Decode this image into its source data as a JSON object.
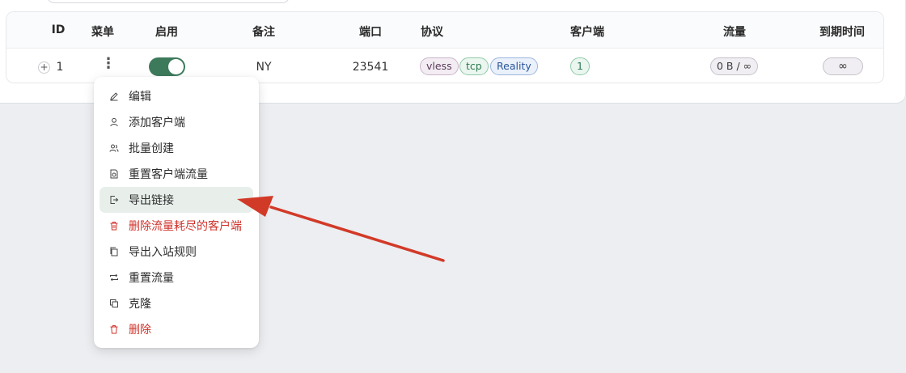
{
  "table": {
    "headers": {
      "id": "ID",
      "menu": "菜单",
      "enable": "启用",
      "remark": "备注",
      "port": "端口",
      "protocol": "协议",
      "clients": "客户端",
      "traffic": "流量",
      "expiry": "到期时间"
    },
    "row": {
      "id": "1",
      "remark": "NY",
      "port": "23541",
      "protocol_tags": [
        "vless",
        "tcp",
        "Reality"
      ],
      "clients": "1",
      "traffic": "0 B / ∞",
      "expiry": "∞",
      "enabled": true
    }
  },
  "menu": {
    "items": [
      {
        "label": "编辑",
        "icon": "edit-icon"
      },
      {
        "label": "添加客户端",
        "icon": "user-add-icon"
      },
      {
        "label": "批量创建",
        "icon": "users-icon"
      },
      {
        "label": "重置客户端流量",
        "icon": "file-reset-icon"
      },
      {
        "label": "导出链接",
        "icon": "export-icon",
        "active": true
      },
      {
        "label": "删除流量耗尽的客户端",
        "icon": "trash-icon",
        "danger": true
      },
      {
        "label": "导出入站规则",
        "icon": "copy-icon"
      },
      {
        "label": "重置流量",
        "icon": "retweet-icon"
      },
      {
        "label": "克隆",
        "icon": "clone-icon"
      },
      {
        "label": "删除",
        "icon": "delete-icon",
        "danger": true
      }
    ]
  },
  "colors": {
    "accent": "#3d7a5c",
    "danger": "#d0322b",
    "arrow": "#d23a28"
  }
}
